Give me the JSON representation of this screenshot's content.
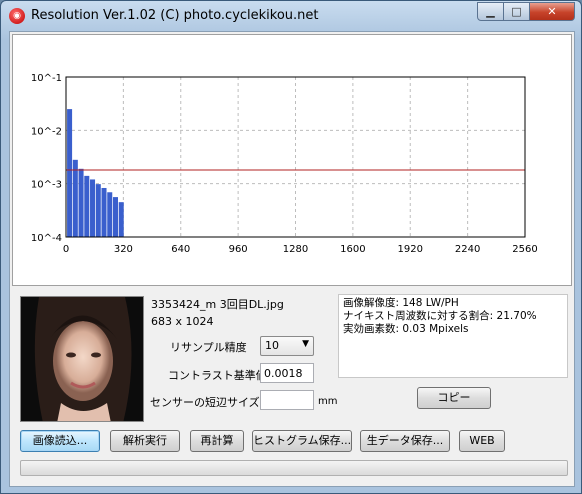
{
  "window": {
    "title": "Resolution Ver.1.02 (C) photo.cyclekikou.net",
    "icon": "app-logo-icon",
    "caption_buttons": {
      "minimize": "minimize-icon",
      "maximize": "maximize-icon",
      "close": "close-icon"
    }
  },
  "chart_data": {
    "type": "bar",
    "y_scale": "log",
    "ylim": [
      0.0001,
      0.1
    ],
    "xlim": [
      0,
      2560
    ],
    "x_tick_labels": [
      "0",
      "320",
      "640",
      "960",
      "1280",
      "1600",
      "1920",
      "2240",
      "2560"
    ],
    "y_tick_labels": [
      "10^-1",
      "10^-2",
      "10^-3",
      "10^-4"
    ],
    "grid": true,
    "bar_color": "#3a5fcd",
    "threshold": {
      "value": 0.0018,
      "color": "#b22222"
    },
    "bars": [
      {
        "x": 20,
        "y": 0.025
      },
      {
        "x": 52,
        "y": 0.0028
      },
      {
        "x": 84,
        "y": 0.0019
      },
      {
        "x": 116,
        "y": 0.0014
      },
      {
        "x": 148,
        "y": 0.0012
      },
      {
        "x": 180,
        "y": 0.00098
      },
      {
        "x": 212,
        "y": 0.00083
      },
      {
        "x": 244,
        "y": 0.00069
      },
      {
        "x": 276,
        "y": 0.00056
      },
      {
        "x": 308,
        "y": 0.00045
      }
    ]
  },
  "image_info": {
    "filename": "3353424_m 3回目DL.jpg",
    "dimensions": "683 x 1024"
  },
  "settings": {
    "resample_label": "リサンプル精度",
    "resample_value": "10",
    "contrast_label": "コントラスト基準値",
    "contrast_value": "0.0018",
    "sensor_label": "センサーの短辺サイズ",
    "sensor_value": "",
    "sensor_unit": "mm"
  },
  "results": {
    "line1": "画像解像度: 148 LW/PH",
    "line2": "ナイキスト周波数に対する割合: 21.70%",
    "line3": "実効画素数: 0.03 Mpixels"
  },
  "buttons": {
    "copy": "コピー",
    "load": "画像読込...",
    "analyze": "解析実行",
    "recalc": "再計算",
    "save_hist": "ヒストグラム保存...",
    "save_raw": "生データ保存...",
    "web": "WEB"
  },
  "progress": {
    "value": 0
  }
}
